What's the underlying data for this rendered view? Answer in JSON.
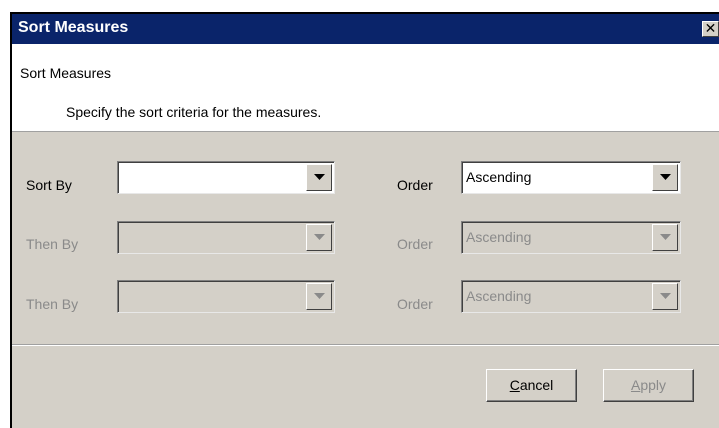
{
  "window": {
    "title": "Sort Measures",
    "close_glyph": "✕"
  },
  "header": {
    "title": "Sort Measures",
    "description": "Specify the sort criteria for the measures."
  },
  "rows": [
    {
      "field_label": "Sort By",
      "field_value": "",
      "order_label": "Order",
      "order_value": "Ascending",
      "enabled": true
    },
    {
      "field_label": "Then By",
      "field_value": "",
      "order_label": "Order",
      "order_value": "Ascending",
      "enabled": false
    },
    {
      "field_label": "Then By",
      "field_value": "",
      "order_label": "Order",
      "order_value": "Ascending",
      "enabled": false
    }
  ],
  "buttons": {
    "cancel": {
      "mnemonic": "C",
      "rest": "ancel",
      "enabled": true
    },
    "apply": {
      "mnemonic": "A",
      "rest": "pply",
      "enabled": false
    }
  },
  "colors": {
    "title_bar": "#0a246a",
    "dialog_face": "#d4d0c8",
    "disabled_text": "#8a8a8a"
  }
}
